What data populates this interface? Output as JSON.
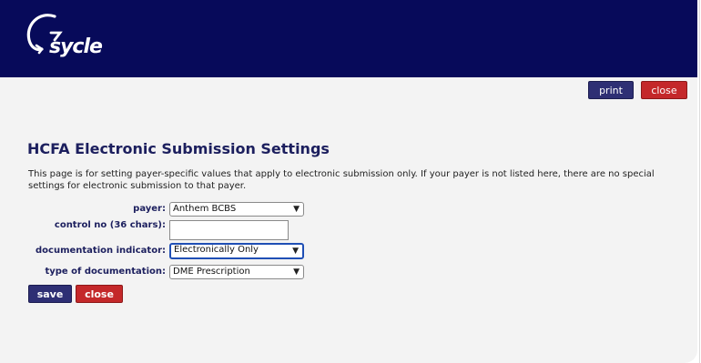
{
  "header": {
    "logo_text": "sycle"
  },
  "top_actions": {
    "print_label": "print",
    "close_label": "close"
  },
  "page": {
    "title": "HCFA Electronic Submission Settings",
    "intro": "This page is for setting payer-specific values that apply to electronic submission only. If your payer is not listed here, there are no special settings for electronic submission to that payer."
  },
  "form": {
    "payer": {
      "label": "payer:",
      "value": "Anthem BCBS"
    },
    "control_no": {
      "label": "control no (36 chars):",
      "value": ""
    },
    "documentation_indicator": {
      "label": "documentation indicator:",
      "value": "Electronically Only"
    },
    "type_of_documentation": {
      "label": "type of documentation:",
      "value": "DME Prescription"
    }
  },
  "bottom_actions": {
    "save_label": "save",
    "close_label": "close"
  },
  "colors": {
    "header_bg": "#070a5a",
    "primary_button": "#2e2f74",
    "danger_button": "#c4282a",
    "label_text": "#1c1f5e",
    "focus_ring": "#1f4fb5"
  },
  "icons": {
    "select_arrow": "chevron-down-icon"
  }
}
